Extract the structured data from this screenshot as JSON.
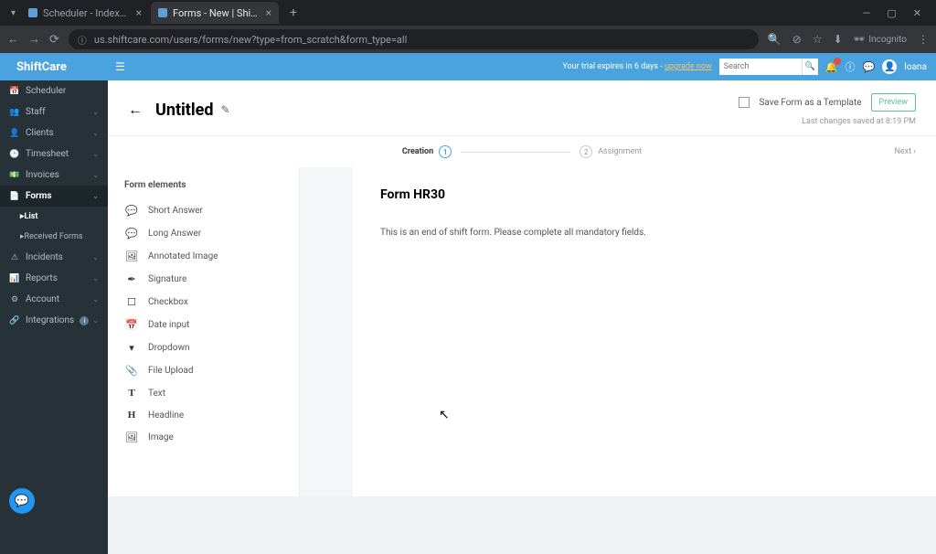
{
  "browser": {
    "tabs": [
      {
        "title": "Scheduler - Index | ShiftCare |"
      },
      {
        "title": "Forms - New | ShiftCare | Ioana"
      }
    ],
    "url": "us.shiftcare.com/users/forms/new?type=from_scratch&form_type=all",
    "incognito": "Incognito"
  },
  "topbar": {
    "brand": "ShiftCare",
    "trial": "Your trial expires in 6 days - ",
    "trial_link": "upgrade now",
    "search_placeholder": "Search",
    "user": "Ioana"
  },
  "sidebar": {
    "items": [
      {
        "icon": "📅",
        "label": "Scheduler"
      },
      {
        "icon": "👥",
        "label": "Staff"
      },
      {
        "icon": "👤",
        "label": "Clients"
      },
      {
        "icon": "🕒",
        "label": "Timesheet"
      },
      {
        "icon": "💵",
        "label": "Invoices"
      },
      {
        "icon": "📄",
        "label": "Forms"
      },
      {
        "icon": "⚠",
        "label": "Incidents"
      },
      {
        "icon": "📊",
        "label": "Reports"
      },
      {
        "icon": "⚙",
        "label": "Account"
      },
      {
        "icon": "🔗",
        "label": "Integrations"
      }
    ],
    "sub": [
      {
        "label": "List"
      },
      {
        "label": "Received Forms"
      }
    ]
  },
  "header": {
    "title": "Untitled",
    "template_label": "Save Form as a Template",
    "preview": "Preview",
    "saved": "Last changes saved at 8:19 PM"
  },
  "stepper": {
    "step1": "Creation",
    "step2": "Assignment",
    "next": "Next"
  },
  "elements": {
    "title": "Form elements",
    "items": [
      {
        "icon": "💬",
        "label": "Short Answer"
      },
      {
        "icon": "💬",
        "label": "Long Answer"
      },
      {
        "icon": "🖼",
        "label": "Annotated Image"
      },
      {
        "icon": "✒",
        "label": "Signature"
      },
      {
        "icon": "☐",
        "label": "Checkbox"
      },
      {
        "icon": "📅",
        "label": "Date input"
      },
      {
        "icon": "▾",
        "label": "Dropdown"
      },
      {
        "icon": "📎",
        "label": "File Upload"
      },
      {
        "icon": "T",
        "label": "Text"
      },
      {
        "icon": "H",
        "label": "Headline"
      },
      {
        "icon": "🖼",
        "label": "Image"
      }
    ]
  },
  "form": {
    "title": "Form HR30",
    "description": "This is an end of shift form. Please complete all mandatory fields."
  }
}
